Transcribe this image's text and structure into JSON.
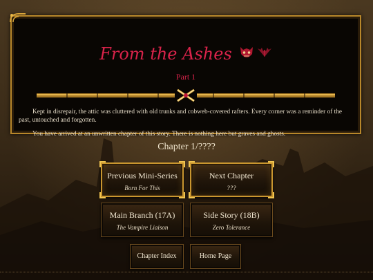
{
  "story": {
    "title": "From the Ashes",
    "part": "Part 1",
    "paragraphs": [
      "Kept in disrepair, the attic was cluttered with old trunks and cobweb-covered rafters. Every corner was a reminder of the past, untouched and forgotten.",
      "You have arrived at an unwritten chapter of this story. There is nothing here but graves and ghosts."
    ],
    "title_icons": [
      "demon-mask-icon",
      "bat-wings-icon"
    ]
  },
  "chapter_count": "Chapter 1/????",
  "nav": {
    "previous": {
      "label": "Previous Mini-Series",
      "sub": "Born For This"
    },
    "next": {
      "label": "Next Chapter",
      "sub": "???"
    },
    "main_branch": {
      "label": "Main Branch (17A)",
      "sub": "The Vampire Liaison"
    },
    "side_story": {
      "label": "Side Story (18B)",
      "sub": "Zero Tolerance"
    },
    "chapter_index": {
      "label": "Chapter Index"
    },
    "home_page": {
      "label": "Home Page"
    }
  },
  "colors": {
    "accent_title": "#d8234a",
    "gold_border": "#c9962f",
    "panel_bg": "#090603"
  }
}
